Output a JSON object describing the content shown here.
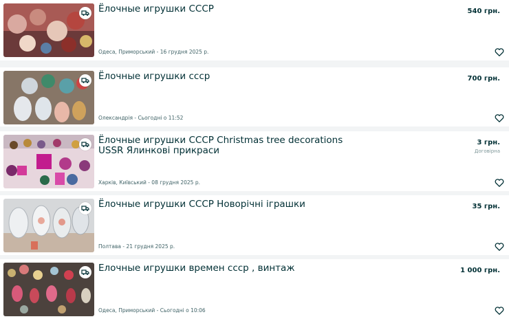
{
  "listings": [
    {
      "title": "Ёлочные игрушки СССР",
      "location": "Одеса, Приморський - 16 грудня 2025 р.",
      "price": "540 грн.",
      "price_note": ""
    },
    {
      "title": "Ёлочные игрушки ссср",
      "location": "Олександрія - Сьогодні о 11:52",
      "price": "700 грн.",
      "price_note": ""
    },
    {
      "title": "Ёлочные игрушки СССР Christmas tree decorations USSR Ялинкові прикраси",
      "location": "Харків, Київський - 08 грудня 2025 р.",
      "price": "3 грн.",
      "price_note": "Договірна"
    },
    {
      "title": "Ёлочные игрушки СССР Новорічні іграшки",
      "location": "Полтава - 21 грудня 2025 р.",
      "price": "35 грн.",
      "price_note": ""
    },
    {
      "title": "Елочные игрушки времен ссср , винтаж",
      "location": "Одеса, Приморський - Сьогодні о 10:06",
      "price": "1 000 грн.",
      "price_note": ""
    }
  ],
  "icons": {
    "delivery": "delivery-truck-icon",
    "favorite": "heart-outline-icon"
  },
  "colors": {
    "text": "#002f34",
    "muted": "#406367",
    "background": "#f2f4f5"
  }
}
